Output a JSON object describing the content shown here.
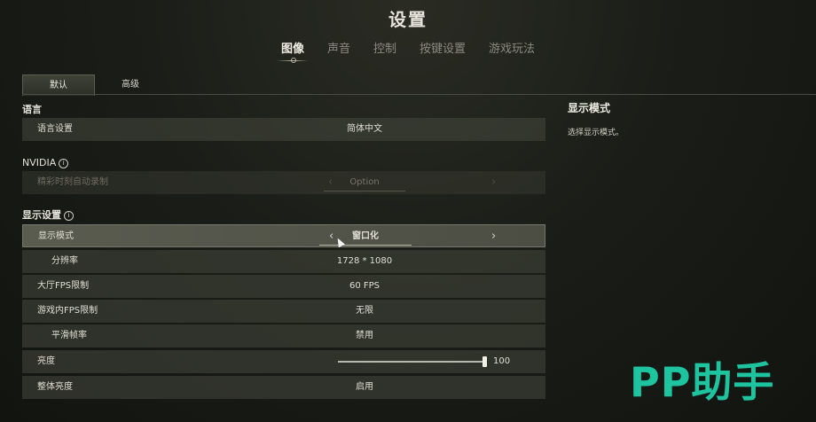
{
  "title": "设置",
  "top_nav": [
    {
      "label": "图像",
      "active": true
    },
    {
      "label": "声音",
      "active": false
    },
    {
      "label": "控制",
      "active": false
    },
    {
      "label": "按键设置",
      "active": false
    },
    {
      "label": "游戏玩法",
      "active": false
    }
  ],
  "sub_tabs": [
    {
      "label": "默认",
      "active": true
    },
    {
      "label": "高级",
      "active": false
    }
  ],
  "sections": {
    "language": "语言",
    "nvidia": "NVIDIA",
    "display": "显示设置"
  },
  "info_icon_glyph": "i",
  "rows": {
    "language_setting": {
      "label": "语言设置",
      "value": "简体中文"
    },
    "highlight_record": {
      "label": "精彩时刻自动录制",
      "value": "Option",
      "prev": "‹",
      "next": "›"
    },
    "display_mode": {
      "label": "显示模式",
      "value": "窗口化",
      "prev": "‹",
      "next": "›"
    },
    "resolution": {
      "label": "分辨率",
      "value": "1728 * 1080"
    },
    "lobby_fps": {
      "label": "大厅FPS限制",
      "value": "60 FPS"
    },
    "ingame_fps": {
      "label": "游戏内FPS限制",
      "value": "无限"
    },
    "smooth_framerate": {
      "label": "平滑帧率",
      "value": "禁用"
    },
    "brightness": {
      "label": "亮度",
      "value": "100",
      "level_percent": 100
    },
    "overall_brightness": {
      "label": "整体亮度",
      "value": "启用"
    }
  },
  "description_panel": {
    "heading": "显示模式",
    "text": "选择显示模式。"
  },
  "watermark": "PP助手",
  "colors": {
    "accent_watermark": "#1ec3a0",
    "row_bg": "#46483e",
    "selected_row_bg": "#5a5c50"
  }
}
